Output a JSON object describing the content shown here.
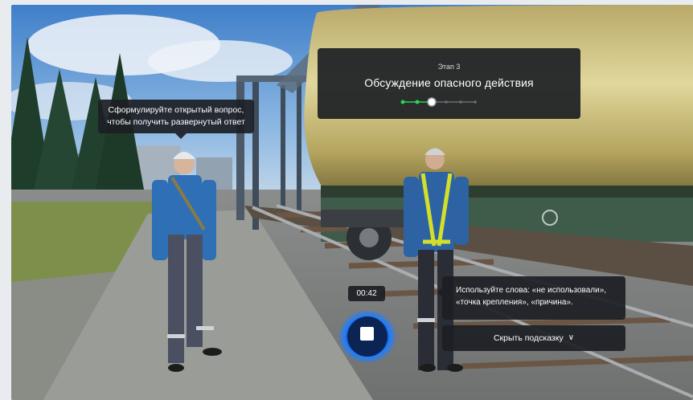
{
  "question_tip": {
    "line1": "Сформулируйте открытый вопрос,",
    "line2": "чтобы получить развернутый ответ"
  },
  "stage": {
    "label": "Этап 3",
    "title": "Обсуждение опасного действия",
    "current_step": 3,
    "total_steps": 6
  },
  "hint": {
    "line1": "Используйте слова: «не использовали»,",
    "line2": "«точка крепления», «причина»."
  },
  "hide_hint_button": {
    "label": "Скрыть подсказку",
    "icon": "chevron-down-icon"
  },
  "recorder": {
    "timer": "00:42",
    "icon": "stop-icon"
  },
  "colors": {
    "panel": "#1c1e24",
    "progress_done": "#2bd34f",
    "record_glow": "#1f7dff"
  }
}
